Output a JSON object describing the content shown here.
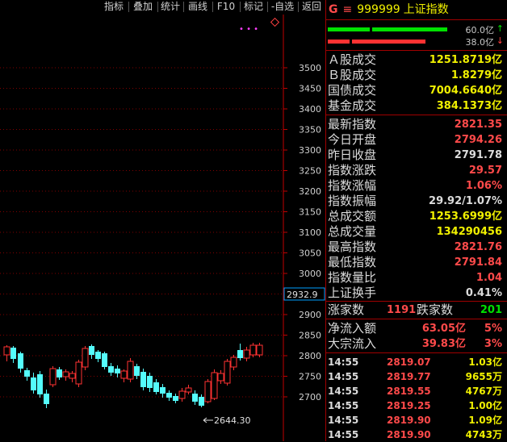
{
  "toolbar": {
    "buttons": [
      "指标",
      "叠加",
      "统计",
      "画线",
      "F10",
      "标记",
      "-自选",
      "返回"
    ]
  },
  "chart": {
    "price_axis": [
      "3500",
      "3450",
      "3400",
      "3350",
      "3300",
      "3250",
      "3200",
      "3150",
      "3100",
      "3050",
      "3000",
      "2950",
      "2900",
      "2850",
      "2800",
      "2750",
      "2700"
    ],
    "current_price_label": "2932.9",
    "low_marker_label": "2644.30",
    "colors": {
      "up": "#ff3232",
      "down": "#54fcfc",
      "grid": "#800000",
      "axis": "#c00000"
    }
  },
  "panel": {
    "title": {
      "g": "G",
      "menu": "≡",
      "code": "999999",
      "name": "上证指数"
    },
    "bars": [
      {
        "label": "60.0亿",
        "arrow": "↑",
        "arrow_color": "#00e000"
      },
      {
        "label": "38.0亿",
        "arrow": "↓",
        "arrow_color": "#ff4040"
      }
    ],
    "volume_rows": [
      {
        "label": "Ａ股成交",
        "value": "1251.8719亿"
      },
      {
        "label": "Ｂ股成交",
        "value": "1.8279亿"
      },
      {
        "label": "国债成交",
        "value": "7004.6640亿"
      },
      {
        "label": "基金成交",
        "value": "384.1373亿"
      }
    ],
    "index_rows": [
      {
        "label": "最新指数",
        "value": "2821.35",
        "color": "#ff4a4a"
      },
      {
        "label": "今日开盘",
        "value": "2794.26",
        "color": "#ff4a4a"
      },
      {
        "label": "昨日收盘",
        "value": "2791.78",
        "color": "#dcdcdc"
      },
      {
        "label": "指数涨跌",
        "value": "29.57",
        "color": "#ff4a4a"
      },
      {
        "label": "指数涨幅",
        "value": "1.06%",
        "color": "#ff4a4a"
      },
      {
        "label": "指数振幅",
        "value": "29.92/1.07%",
        "color": "#dcdcdc"
      },
      {
        "label": "总成交额",
        "value": "1253.6999亿",
        "color": "#f0f000"
      },
      {
        "label": "总成交量",
        "value": "134290456",
        "color": "#f0f000"
      },
      {
        "label": "最高指数",
        "value": "2821.76",
        "color": "#ff4a4a"
      },
      {
        "label": "最低指数",
        "value": "2791.84",
        "color": "#ff4a4a"
      },
      {
        "label": "指数量比",
        "value": "1.04",
        "color": "#ff4a4a"
      },
      {
        "label": "上证换手",
        "value": "0.41%",
        "color": "#dcdcdc"
      }
    ],
    "breadth": {
      "up_label": "涨家数",
      "up_value": "1191",
      "down_label": "跌家数",
      "down_value": "201"
    },
    "flows": [
      {
        "label": "净流入额",
        "value": "63.05亿",
        "pct": "5%"
      },
      {
        "label": "大宗流入",
        "value": "39.83亿",
        "pct": "3%"
      }
    ],
    "ticks": [
      {
        "time": "14:55",
        "price": "2819.07",
        "vol": "1.03亿"
      },
      {
        "time": "14:55",
        "price": "2819.77",
        "vol": "9655万"
      },
      {
        "time": "14:55",
        "price": "2819.55",
        "vol": "4767万"
      },
      {
        "time": "14:55",
        "price": "2819.25",
        "vol": "1.00亿"
      },
      {
        "time": "14:55",
        "price": "2819.90",
        "vol": "1.09亿"
      },
      {
        "time": "14:55",
        "price": "2819.90",
        "vol": "4743万"
      }
    ]
  }
}
